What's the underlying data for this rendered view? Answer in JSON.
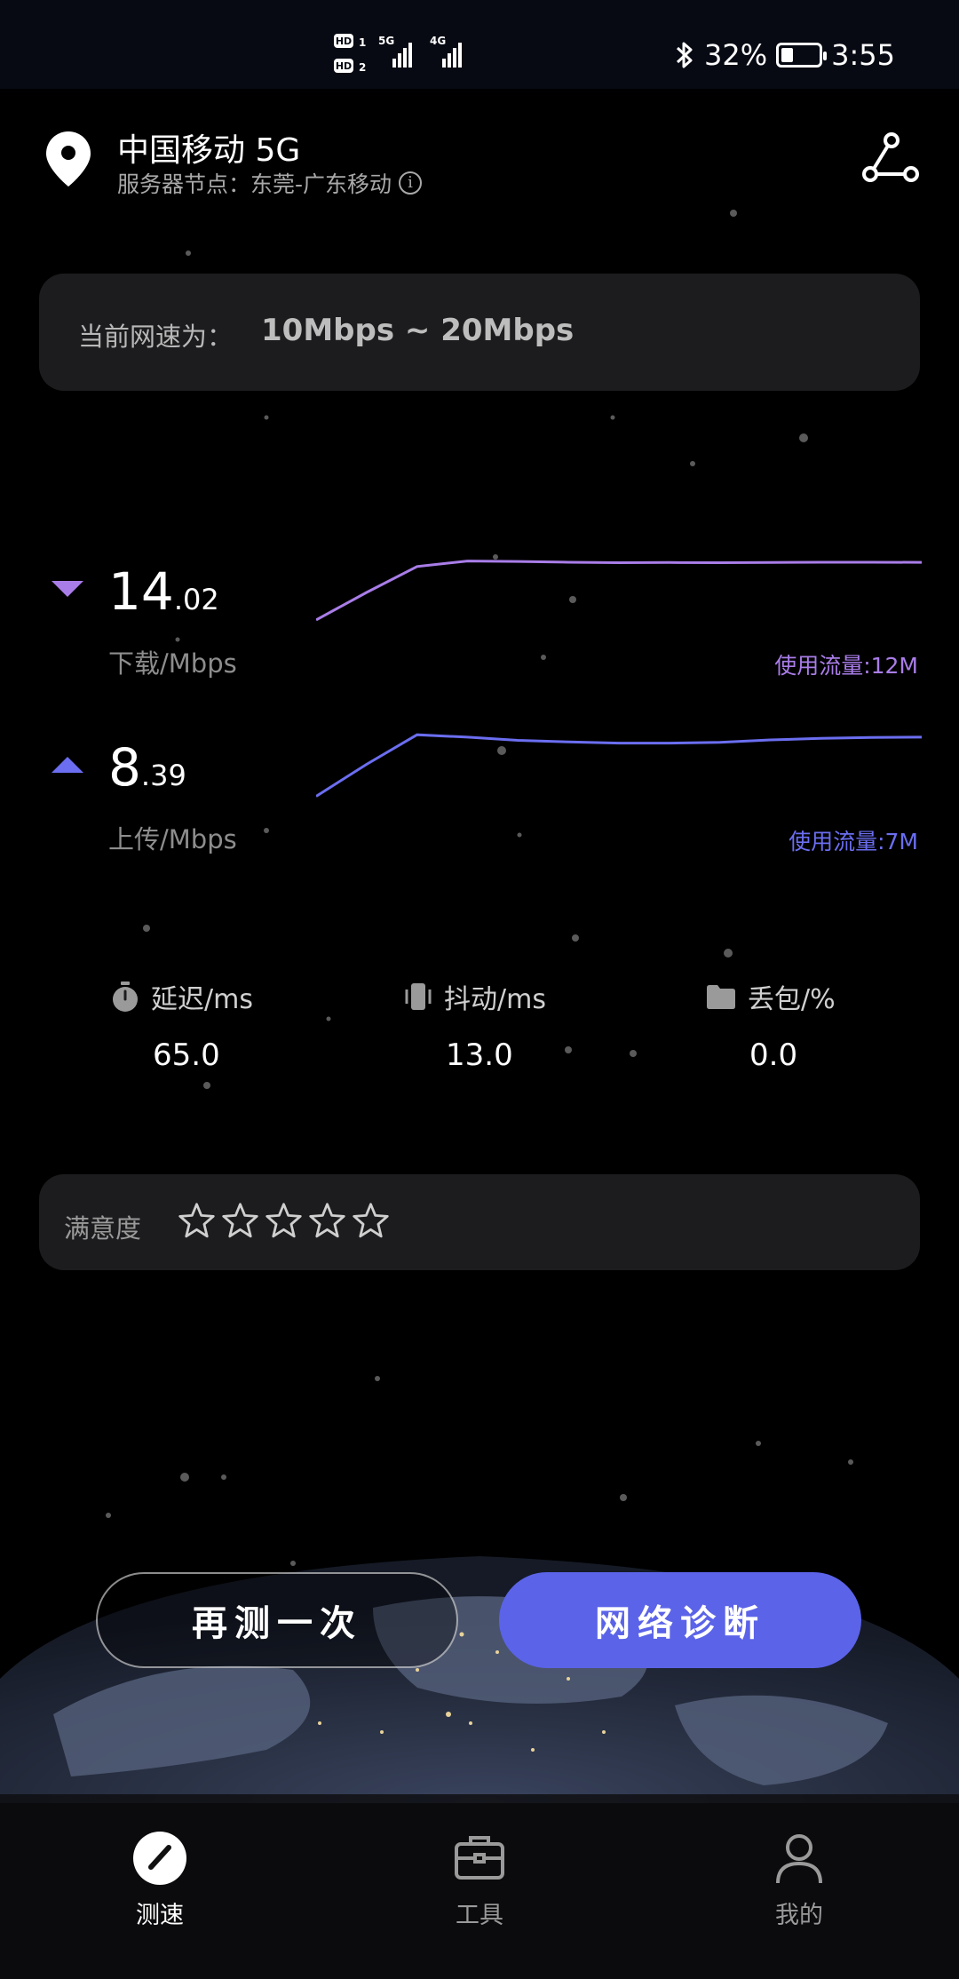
{
  "status_bar": {
    "sim1": "HD1",
    "sim2": "HD2",
    "net1": "5G",
    "net2": "4G",
    "battery_text": "32%",
    "battery_level": 32,
    "time": "3:55"
  },
  "header": {
    "carrier": "中国移动 5G",
    "server_node": "服务器节点：东莞-广东移动"
  },
  "speed_card": {
    "label": "当前网速为：",
    "value": "10Mbps ~ 20Mbps"
  },
  "download": {
    "int": "14",
    "dec": ".02",
    "unit": "下载/Mbps",
    "usage": "使用流量:12M",
    "series": [
      2.5,
      8,
      13.2,
      14.3,
      14.2,
      14.05,
      13.95,
      14.0,
      13.95,
      14.0,
      14.05,
      14.05,
      14.02
    ]
  },
  "upload": {
    "int": "8",
    "dec": ".39",
    "unit": "上传/Mbps",
    "usage": "使用流量:7M",
    "series": [
      1.5,
      5.5,
      9.2,
      8.9,
      8.5,
      8.3,
      8.15,
      8.15,
      8.25,
      8.55,
      8.75,
      8.85,
      8.9
    ]
  },
  "stats": {
    "latency": {
      "label": "延迟/ms",
      "value": "65.0"
    },
    "jitter": {
      "label": "抖动/ms",
      "value": "13.0"
    },
    "loss": {
      "label": "丢包/%",
      "value": "0.0"
    }
  },
  "satisfaction": {
    "label": "满意度",
    "rating": 0,
    "max": 5
  },
  "buttons": {
    "retest": "再测一次",
    "diagnose": "网络诊断"
  },
  "nav": {
    "speed": "测速",
    "tools": "工具",
    "mine": "我的"
  },
  "colors": {
    "download": "#a97de8",
    "upload": "#6b6ef0",
    "accent": "#5b63e8"
  }
}
